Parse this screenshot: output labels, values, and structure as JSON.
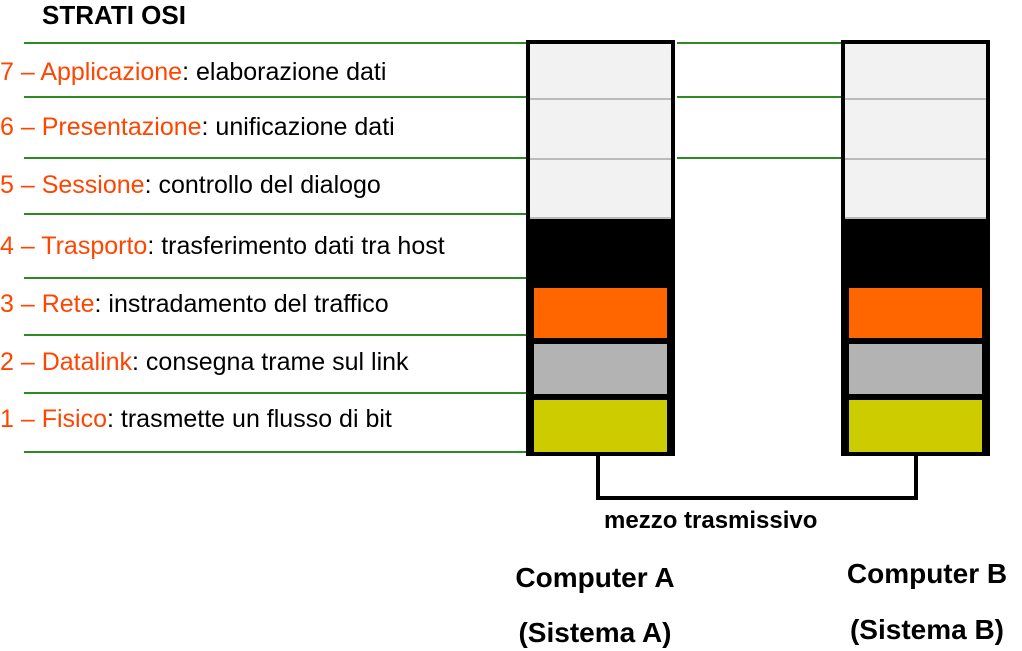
{
  "title": "STRATI OSI",
  "layers": [
    {
      "num": "7",
      "sep": " – ",
      "name": "Applicazione",
      "desc": ": elaborazione dati"
    },
    {
      "num": "6",
      "sep": " – ",
      "name": "Presentazione",
      "desc": ": unificazione dati"
    },
    {
      "num": "5",
      "sep": " – ",
      "name": "Sessione",
      "desc": ": controllo del dialogo"
    },
    {
      "num": "4",
      "sep": " – ",
      "name": "Trasporto",
      "desc": ": trasferimento dati tra host"
    },
    {
      "num": "3",
      "sep": " – ",
      "name": "Rete",
      "desc": ": instradamento del traffico"
    },
    {
      "num": "2",
      "sep": " – ",
      "name": "Datalink",
      "desc": ": consegna trame sul link"
    },
    {
      "num": "1",
      "sep": " – ",
      "name": "Fisico",
      "desc": ": trasmette un flusso di bit"
    }
  ],
  "medium_label": "mezzo trasmissivo",
  "computer_a": {
    "name": "Computer A",
    "system": "(Sistema A)"
  },
  "computer_b": {
    "name": "Computer B",
    "system": "(Sistema B)"
  },
  "colors": {
    "label_accent": "#ff4500",
    "guide_line": "#2e8b22",
    "upper_layers": "#f2f2f2",
    "transport": "#000000",
    "network": "#ff6600",
    "datalink": "#b3b3b3",
    "physical": "#cccc00"
  }
}
